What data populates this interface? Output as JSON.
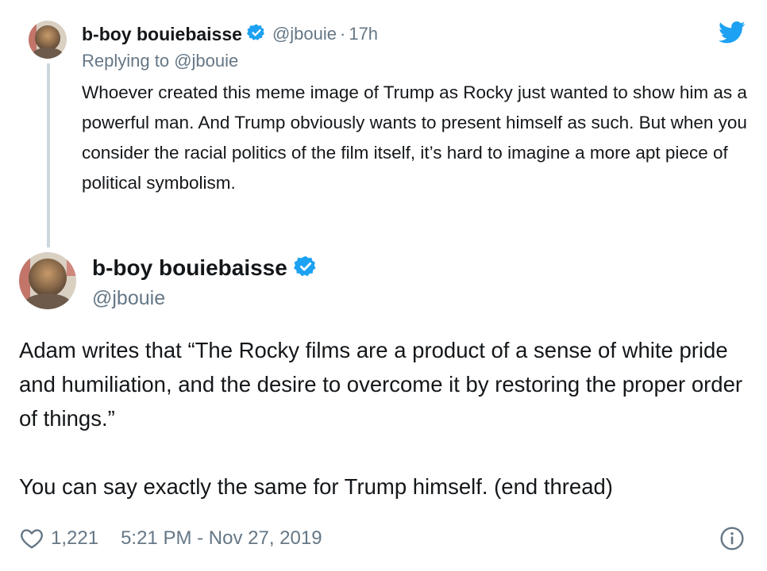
{
  "reply_tweet": {
    "author_name": "b-boy bouiebaisse",
    "handle": "@jbouie",
    "separator": "·",
    "age": "17h",
    "replying_prefix": "Replying to",
    "replying_handle": "@jbouie",
    "text": "Whoever created this meme image of Trump as Rocky just wanted to show him as a powerful man. And Trump obviously wants to present himself as such. But when you consider the racial politics of the film itself, it’s hard to imagine a more apt piece of political symbolism."
  },
  "main_tweet": {
    "author_name": "b-boy bouiebaisse",
    "handle": "@jbouie",
    "paragraphs": [
      "Adam writes that “The Rocky films are a product of a sense of white pride and humiliation, and the desire to overcome it by restoring the proper order of things.”",
      "You can say exactly the same for Trump himself. (end thread)"
    ],
    "like_count": "1,221",
    "timestamp": "5:21 PM - Nov 27, 2019"
  },
  "icons": {
    "verified": "verified-badge-icon",
    "brand": "twitter-bird-icon",
    "like": "heart-icon",
    "info": "info-icon"
  },
  "colors": {
    "brand_blue": "#1da1f2",
    "text_primary": "#14171a",
    "text_secondary": "#657786",
    "thread_line": "#ccd6dd"
  }
}
